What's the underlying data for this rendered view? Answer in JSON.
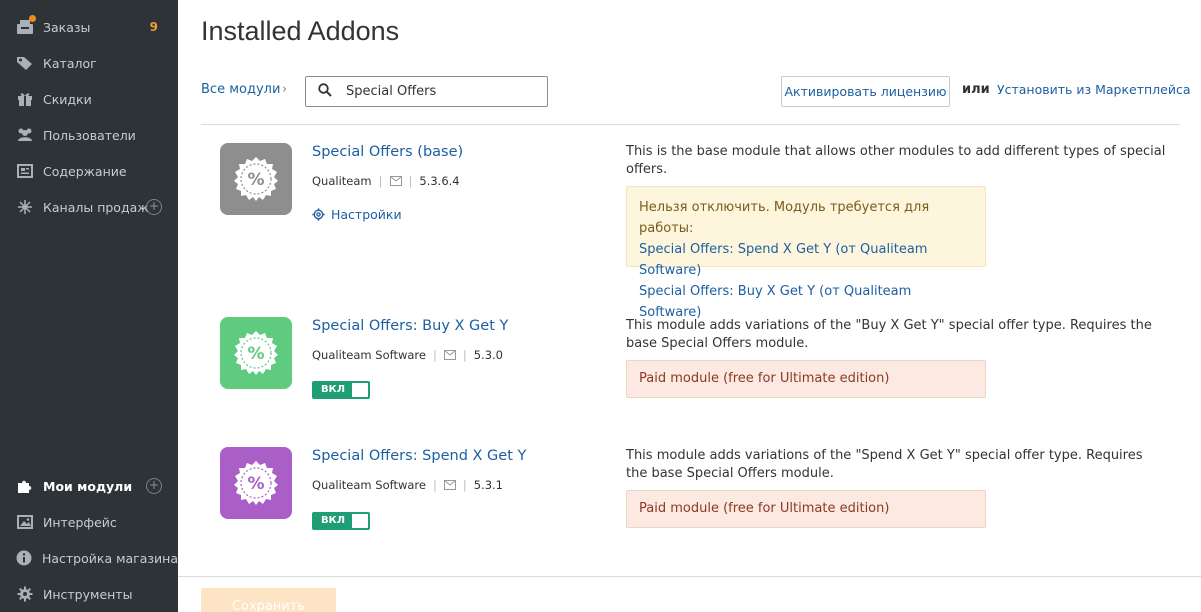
{
  "sidebar": {
    "orders": {
      "label": "Заказы",
      "count": "9"
    },
    "catalog": {
      "label": "Каталог"
    },
    "discounts": {
      "label": "Скидки"
    },
    "users": {
      "label": "Пользователи"
    },
    "content": {
      "label": "Содержание"
    },
    "sales_channels": {
      "label": "Каналы продаж"
    },
    "my_modules": {
      "label": "Мои модули"
    },
    "interface": {
      "label": "Интерфейс"
    },
    "store_setup": {
      "label": "Настройка магазина"
    },
    "tools": {
      "label": "Инструменты"
    }
  },
  "header": {
    "title": "Installed Addons",
    "breadcrumb": "Все модули",
    "breadcrumb_sep": "›",
    "search_value": "Special Offers",
    "activate_license": "Активировать лицензию",
    "or": "или",
    "marketplace": "Установить из Маркетплейса"
  },
  "addons": [
    {
      "name": "Special Offers (base)",
      "vendor": "Qualiteam",
      "version": "5.3.6.4",
      "icon_color": "#8e8e8e",
      "settings": "Настройки",
      "description": "This is the base module that allows other modules to add different types of special offers.",
      "notice_title": "Нельзя отключить. Модуль требуется для работы:",
      "notice_links": [
        "Special Offers: Spend X Get Y (от Qualiteam Software)",
        "Special Offers: Buy X Get Y (от Qualiteam Software)"
      ]
    },
    {
      "name": "Special Offers: Buy X Get Y",
      "vendor": "Qualiteam Software",
      "version": "5.3.0",
      "icon_color": "#5ecb7f",
      "toggle": "ВКЛ",
      "description": "This module adds variations of the \"Buy X Get Y\" special offer type. Requires the base Special Offers module.",
      "notice": "Paid module (free for Ultimate edition)"
    },
    {
      "name": "Special Offers: Spend X Get Y",
      "vendor": "Qualiteam Software",
      "version": "5.3.1",
      "icon_color": "#a95fc5",
      "toggle": "ВКЛ",
      "description": "This module adds variations of the \"Spend X Get Y\" special offer type. Requires the base Special Offers module.",
      "notice": "Paid module (free for Ultimate edition)"
    }
  ],
  "footer": {
    "save": "Сохранить"
  },
  "colors": {
    "sidebar_bg": "#2e3338",
    "link": "#1d5fa1",
    "toggle_on": "#1f9e75",
    "badge": "#f0a030"
  }
}
